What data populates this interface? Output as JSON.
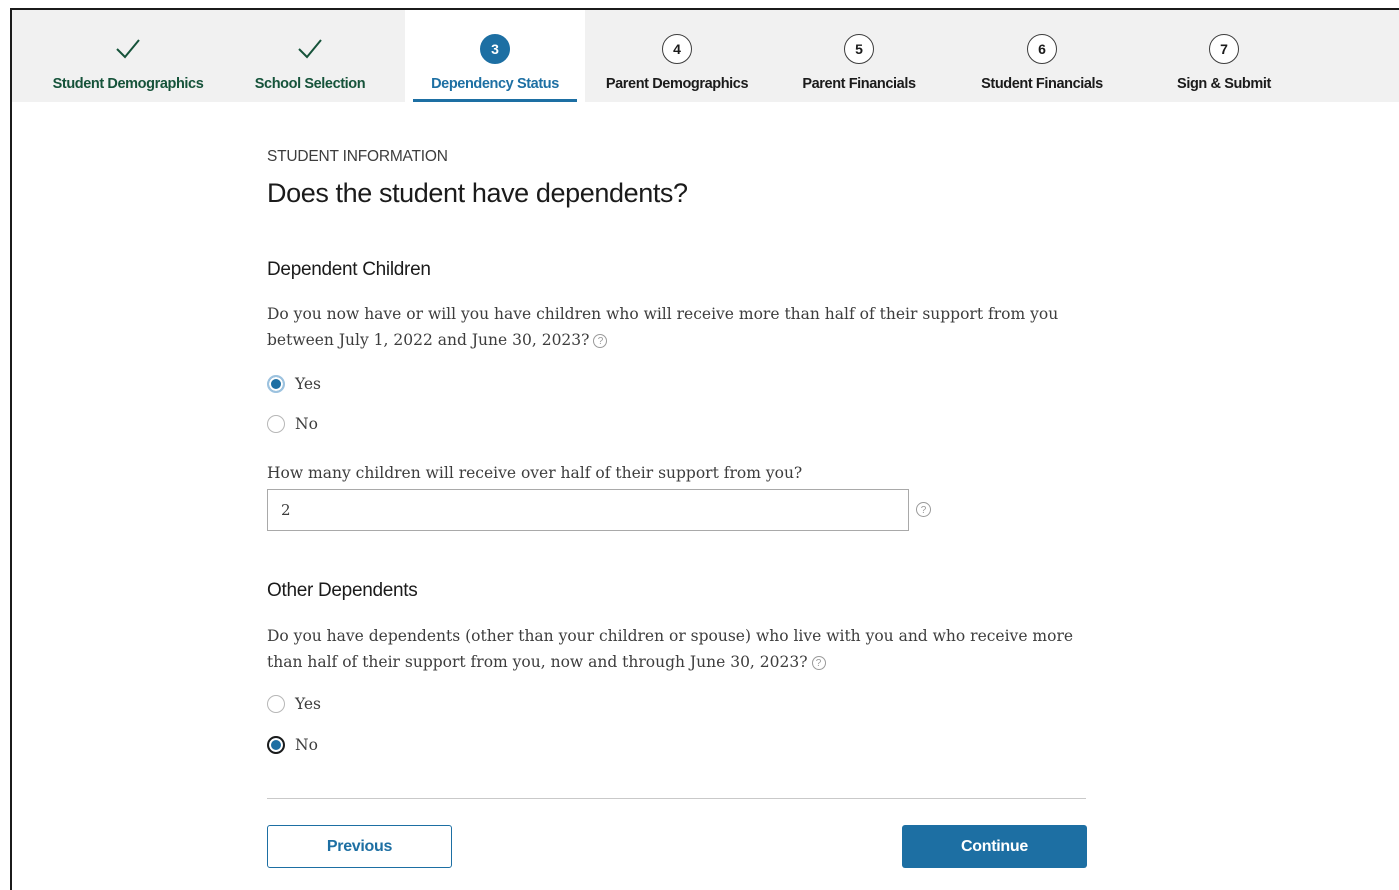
{
  "stepper": {
    "steps": [
      {
        "number": "1",
        "label": "Student Demographics",
        "status": "done"
      },
      {
        "number": "2",
        "label": "School Selection",
        "status": "done"
      },
      {
        "number": "3",
        "label": "Dependency Status",
        "status": "active"
      },
      {
        "number": "4",
        "label": "Parent Demographics",
        "status": "upcoming"
      },
      {
        "number": "5",
        "label": "Parent Financials",
        "status": "upcoming"
      },
      {
        "number": "6",
        "label": "Student Financials",
        "status": "upcoming"
      },
      {
        "number": "7",
        "label": "Sign & Submit",
        "status": "upcoming"
      }
    ]
  },
  "page": {
    "section_label": "STUDENT INFORMATION",
    "title": "Does the student have dependents?"
  },
  "dependent_children": {
    "heading": "Dependent Children",
    "question": "Do you now have or will you have children who will receive more than half of their support from you between July 1, 2022 and June 30, 2023?",
    "options": [
      {
        "label": "Yes",
        "selected": true
      },
      {
        "label": "No",
        "selected": false
      }
    ],
    "count_question": "How many children will receive over half of their support from you?",
    "count_value": "2"
  },
  "other_dependents": {
    "heading": "Other Dependents",
    "question": "Do you have dependents (other than your children or spouse) who live with you and who receive more than half of their support from you, now and through June 30, 2023?",
    "options": [
      {
        "label": "Yes",
        "selected": false
      },
      {
        "label": "No",
        "selected": true
      }
    ]
  },
  "help_icon_glyph": "?",
  "buttons": {
    "previous": "Previous",
    "continue": "Continue"
  },
  "colors": {
    "accent": "#1d6fa3",
    "done_check": "#16533a",
    "stepper_bg": "#f1f1f1"
  }
}
